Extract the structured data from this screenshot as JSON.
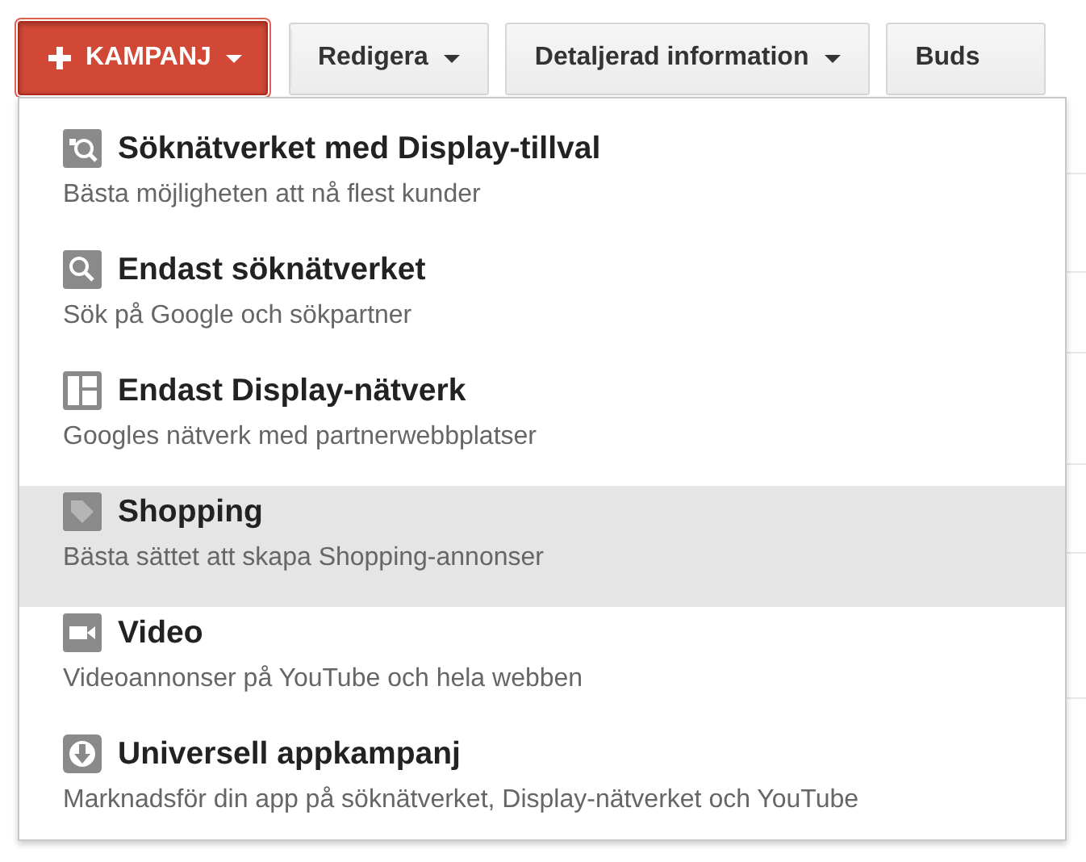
{
  "toolbar": {
    "buttons": [
      {
        "label": "KAMPANJ",
        "kind": "primary",
        "expanded": true
      },
      {
        "label": "Redigera",
        "kind": "default"
      },
      {
        "label": "Detaljerad information",
        "kind": "default"
      },
      {
        "label": "Buds",
        "kind": "default"
      }
    ]
  },
  "menu": {
    "items": [
      {
        "kind": "search-display",
        "title": "Söknätverket med Display-tillval",
        "subtitle": "Bästa möjligheten att nå flest kunder",
        "selected": false
      },
      {
        "kind": "search",
        "title": "Endast söknätverket",
        "subtitle": "Sök på Google och sökpartner",
        "selected": false
      },
      {
        "kind": "layout",
        "title": "Endast Display-nätverk",
        "subtitle": "Googles nätverk med partnerwebbplatser",
        "selected": false
      },
      {
        "kind": "tag",
        "title": "Shopping",
        "subtitle": "Bästa sättet att skapa Shopping-annonser",
        "selected": true
      },
      {
        "kind": "video",
        "title": "Video",
        "subtitle": "Videoannonser på YouTube och hela webben",
        "selected": false
      },
      {
        "kind": "download",
        "title": "Universell appkampanj",
        "subtitle": "Marknadsför din app på söknätverket, Display-nätverket och YouTube",
        "selected": false
      }
    ]
  }
}
